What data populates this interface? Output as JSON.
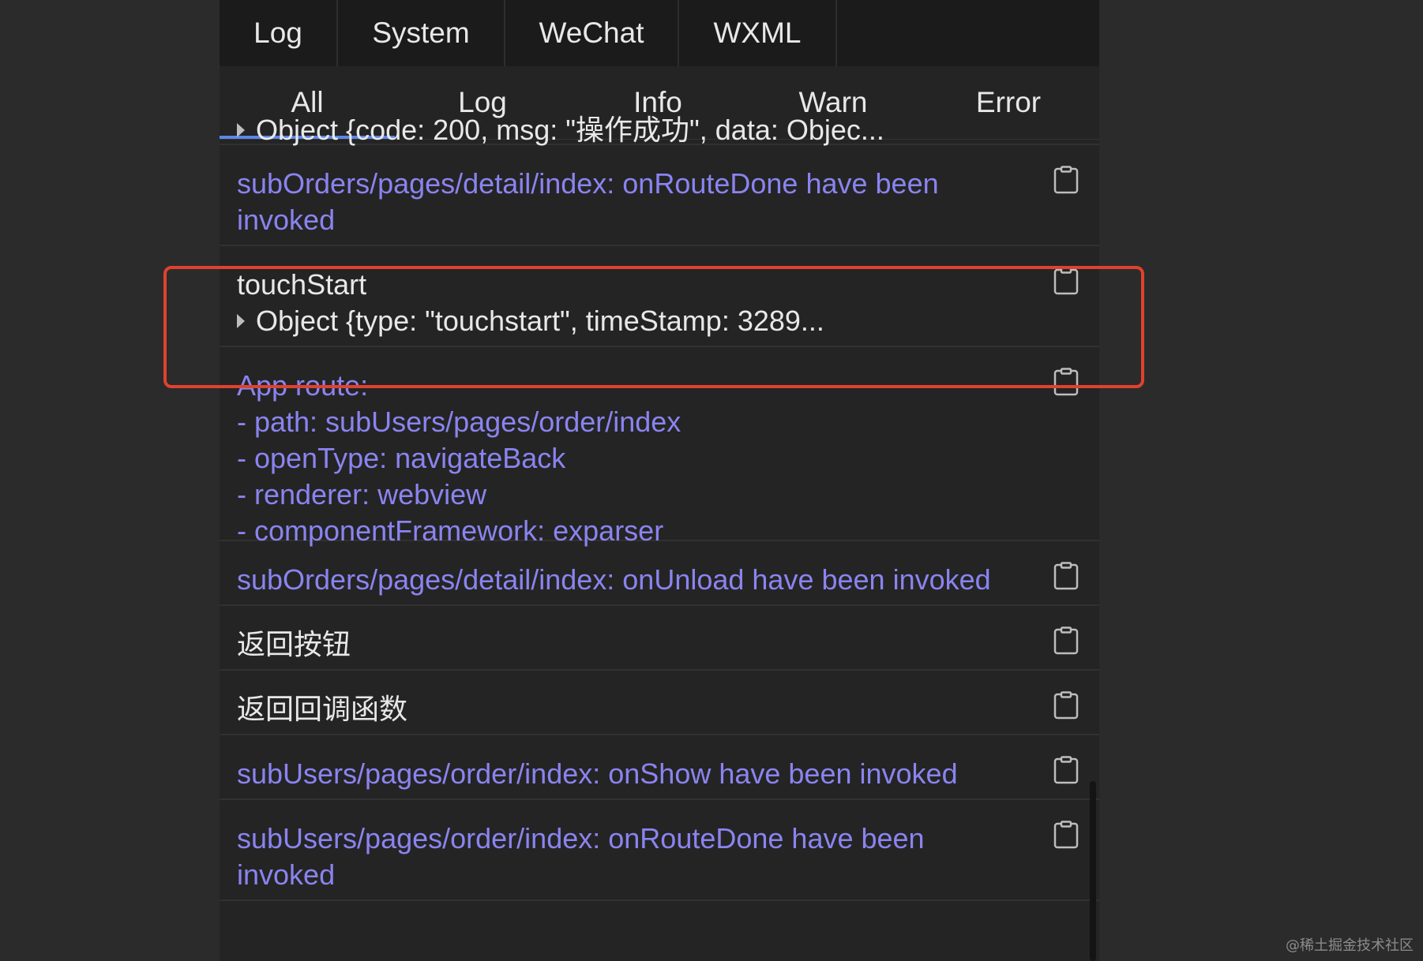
{
  "top_tabs": [
    "Log",
    "System",
    "WeChat",
    "WXML"
  ],
  "filter_tabs": [
    "All",
    "Log",
    "Info",
    "Warn",
    "Error"
  ],
  "active_filter": "All",
  "log_entries": [
    {
      "lines": [
        "Object {code: 200, msg: \"操作成功\", data: Objec..."
      ],
      "color": "white",
      "expandable_object": true
    },
    {
      "lines": [
        "subOrders/pages/detail/index: onRouteDone have been",
        "invoked"
      ],
      "color": "purple"
    },
    {
      "lines": [
        "touchStart",
        "Object {type: \"touchstart\", timeStamp: 3289..."
      ],
      "color": "white",
      "expandable_object": true
    },
    {
      "lines": [
        "App route:",
        "- path: subUsers/pages/order/index",
        "- openType: navigateBack",
        "- renderer: webview",
        "- componentFramework: exparser"
      ],
      "color": "purple"
    },
    {
      "lines": [
        "subOrders/pages/detail/index: onUnload have been invoked"
      ],
      "color": "purple"
    },
    {
      "lines": [
        "返回按钮"
      ],
      "color": "white"
    },
    {
      "lines": [
        "返回回调函数"
      ],
      "color": "white"
    },
    {
      "lines": [
        "subUsers/pages/order/index: onShow have been invoked"
      ],
      "color": "purple"
    },
    {
      "lines": [
        "subUsers/pages/order/index: onRouteDone have been",
        "invoked"
      ],
      "color": "purple"
    }
  ],
  "colors": {
    "purple_text": "#8a84f0",
    "white_text": "#e8e8e8",
    "highlight_border": "#e0412f",
    "active_tab_underline": "#5b86e8"
  },
  "icons": {
    "copy": "clipboard-icon",
    "expand": "caret-right-icon"
  },
  "watermark": "@稀土掘金技术社区"
}
